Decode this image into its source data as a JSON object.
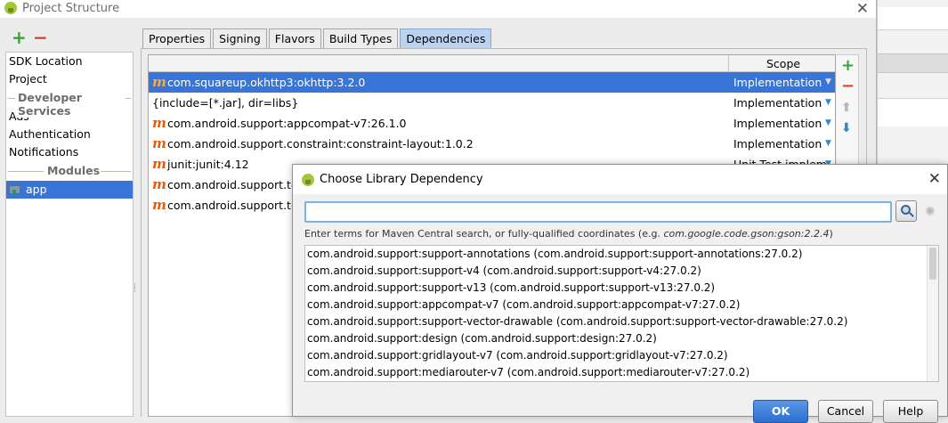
{
  "project_window": {
    "title": "Project Structure",
    "close_glyph": "✕"
  },
  "sidebar": {
    "add_glyph": "+",
    "remove_glyph": "−",
    "items_top": [
      "SDK Location",
      "Project"
    ],
    "section_developer": "Developer Services",
    "items_dev": [
      "Ads",
      "Authentication",
      "Notifications"
    ],
    "section_modules": "Modules",
    "module_item": "app"
  },
  "tabs": [
    "Properties",
    "Signing",
    "Flavors",
    "Build Types",
    "Dependencies"
  ],
  "active_tab": "Dependencies",
  "dependencies": {
    "scope_header": "Scope",
    "rows": [
      {
        "icon": "m",
        "coord": "com.squareup.okhttp3:okhttp:3.2.0",
        "scope": "Implementation",
        "selected": true
      },
      {
        "icon": "",
        "coord": "{include=[*.jar], dir=libs}",
        "scope": "Implementation",
        "selected": false
      },
      {
        "icon": "m",
        "coord": "com.android.support:appcompat-v7:26.1.0",
        "scope": "Implementation",
        "selected": false
      },
      {
        "icon": "m",
        "coord": "com.android.support.constraint:constraint-layout:1.0.2",
        "scope": "Implementation",
        "selected": false
      },
      {
        "icon": "m",
        "coord": "junit:junit:4.12",
        "scope": "Unit Test implem",
        "selected": false
      },
      {
        "icon": "m",
        "coord": "com.android.support.tes",
        "scope": "",
        "selected": false
      },
      {
        "icon": "m",
        "coord": "com.android.support.tes",
        "scope": "",
        "selected": false
      }
    ],
    "side_tools": {
      "add": "+",
      "remove": "−",
      "up": "⬆",
      "down": "⬇"
    }
  },
  "dialog": {
    "title": "Choose Library Dependency",
    "close_glyph": "✕",
    "search_value": "",
    "hint_prefix": "Enter terms for Maven Central search, or fully-qualified coordinates (e.g. ",
    "hint_example": "com.google.code.gson:gson:2.2.4",
    "hint_suffix": ")",
    "libraries": [
      "com.android.support:support-annotations (com.android.support:support-annotations:27.0.2)",
      "com.android.support:support-v4 (com.android.support:support-v4:27.0.2)",
      "com.android.support:support-v13 (com.android.support:support-v13:27.0.2)",
      "com.android.support:appcompat-v7 (com.android.support:appcompat-v7:27.0.2)",
      "com.android.support:support-vector-drawable (com.android.support:support-vector-drawable:27.0.2)",
      "com.android.support:design (com.android.support:design:27.0.2)",
      "com.android.support:gridlayout-v7 (com.android.support:gridlayout-v7:27.0.2)",
      "com.android.support:mediarouter-v7 (com.android.support:mediarouter-v7:27.0.2)"
    ],
    "buttons": {
      "ok": "OK",
      "cancel": "Cancel",
      "help": "Help"
    }
  }
}
